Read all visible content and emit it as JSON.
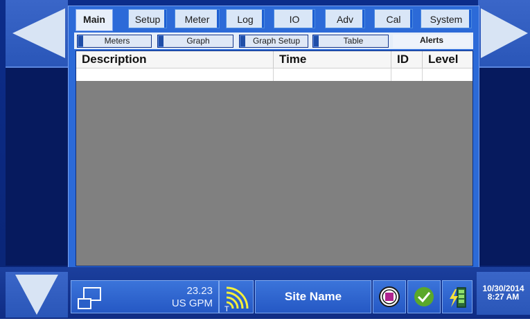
{
  "main_tabs": [
    {
      "label": "Main",
      "active": true
    },
    {
      "label": "Setup",
      "active": false
    },
    {
      "label": "Meter",
      "active": false
    },
    {
      "label": "Log",
      "active": false
    },
    {
      "label": "IO",
      "active": false
    },
    {
      "label": "Adv",
      "active": false
    },
    {
      "label": "Cal",
      "active": false
    },
    {
      "label": "System",
      "active": false
    }
  ],
  "sub_tabs": [
    {
      "label": "Meters",
      "active": false
    },
    {
      "label": "Graph",
      "active": false
    },
    {
      "label": "Graph Setup",
      "active": false
    },
    {
      "label": "Table",
      "active": false
    },
    {
      "label": "Alerts",
      "active": true
    }
  ],
  "alerts_table": {
    "columns": [
      "Description",
      "Time",
      "ID",
      "Level"
    ],
    "rows": []
  },
  "status_bar": {
    "flow_value": "23.23",
    "flow_unit": "US GPM",
    "signal_icon_letter": "T",
    "site_name": "Site Name",
    "date": "10/30/2014",
    "time": "8:27 AM"
  },
  "icons": {
    "nav_left": "left-arrow-icon",
    "nav_right": "right-arrow-icon",
    "nav_down": "down-arrow-icon",
    "windows": "windows-icon",
    "signal": "signal-strength-icon",
    "stop": "stop-icon",
    "ok": "check-ok-icon",
    "battery": "battery-charging-icon"
  },
  "colors": {
    "frame": "#0c2d8a",
    "panel": "#2c6ad8",
    "table_body": "#808080",
    "stop_icon": "#b0238f",
    "ok_icon": "#5aa82a"
  }
}
